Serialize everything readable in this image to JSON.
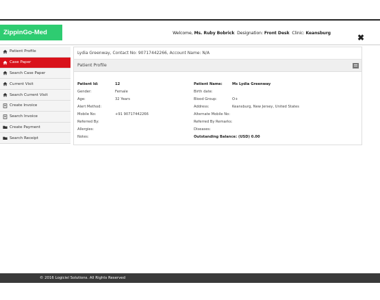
{
  "header": {
    "app_name": "ZippinGo-Med",
    "welcome_label": "Welcome,",
    "user_name": "Ms. Ruby Bobrick",
    "designation_label": "Designation:",
    "designation": "Front Desk",
    "clinic_label": "Clinic:",
    "clinic": "Keansburg",
    "close_glyph": "✖",
    "accent_color": "#2ecc71"
  },
  "sidebar": {
    "active_color": "#d9121b",
    "items": [
      {
        "label": "Patient Profile",
        "icon": "home-icon"
      },
      {
        "label": "Case Paper",
        "icon": "home-icon",
        "active": true
      },
      {
        "label": "Search Case Paper",
        "icon": "home-icon"
      },
      {
        "label": "Current Visit",
        "icon": "home-icon"
      },
      {
        "label": "Search Current Visit",
        "icon": "home-icon"
      },
      {
        "label": "Create Invoice",
        "icon": "invoice-icon"
      },
      {
        "label": "Search Invoice",
        "icon": "invoice-icon"
      },
      {
        "label": "Create Payment",
        "icon": "folder-icon"
      },
      {
        "label": "Search Receipt",
        "icon": "folder-icon"
      }
    ]
  },
  "main": {
    "breadcrumb": "Lydia Greenway, Contact No: 90717442266, Account Name: N/A",
    "panel_title": "Patient Profile",
    "left": [
      {
        "label": "Patient Id:",
        "value": "12",
        "bold": true
      },
      {
        "label": "Gender:",
        "value": "Female"
      },
      {
        "label": "Age:",
        "value": "32 Years"
      },
      {
        "label": "Alert Method:",
        "value": ""
      },
      {
        "label": "Mobile No:",
        "value": "+91 90717442266"
      },
      {
        "label": "Referred By:",
        "value": ""
      },
      {
        "label": "Allergies:",
        "value": ""
      },
      {
        "label": "Notes:",
        "value": ""
      }
    ],
    "right": [
      {
        "label": "Patient Name:",
        "value": "Ms Lydia Greenway",
        "bold": true
      },
      {
        "label": "Birth date:",
        "value": ""
      },
      {
        "label": "Blood Group:",
        "value": "O+"
      },
      {
        "label": "Address:",
        "value": "Keansburg, New Jersey, United States"
      },
      {
        "label": "Alternate Mobile No:",
        "value": ""
      },
      {
        "label": "Referred By Remarks:",
        "value": ""
      },
      {
        "label": "Diseases:",
        "value": ""
      },
      {
        "label": "Outstanding Balance: (USD) 0.00",
        "value": "",
        "bold": true
      }
    ]
  },
  "footer": {
    "copyright": "© 2016 Logiciel Solutions. All Rights Reserved"
  }
}
